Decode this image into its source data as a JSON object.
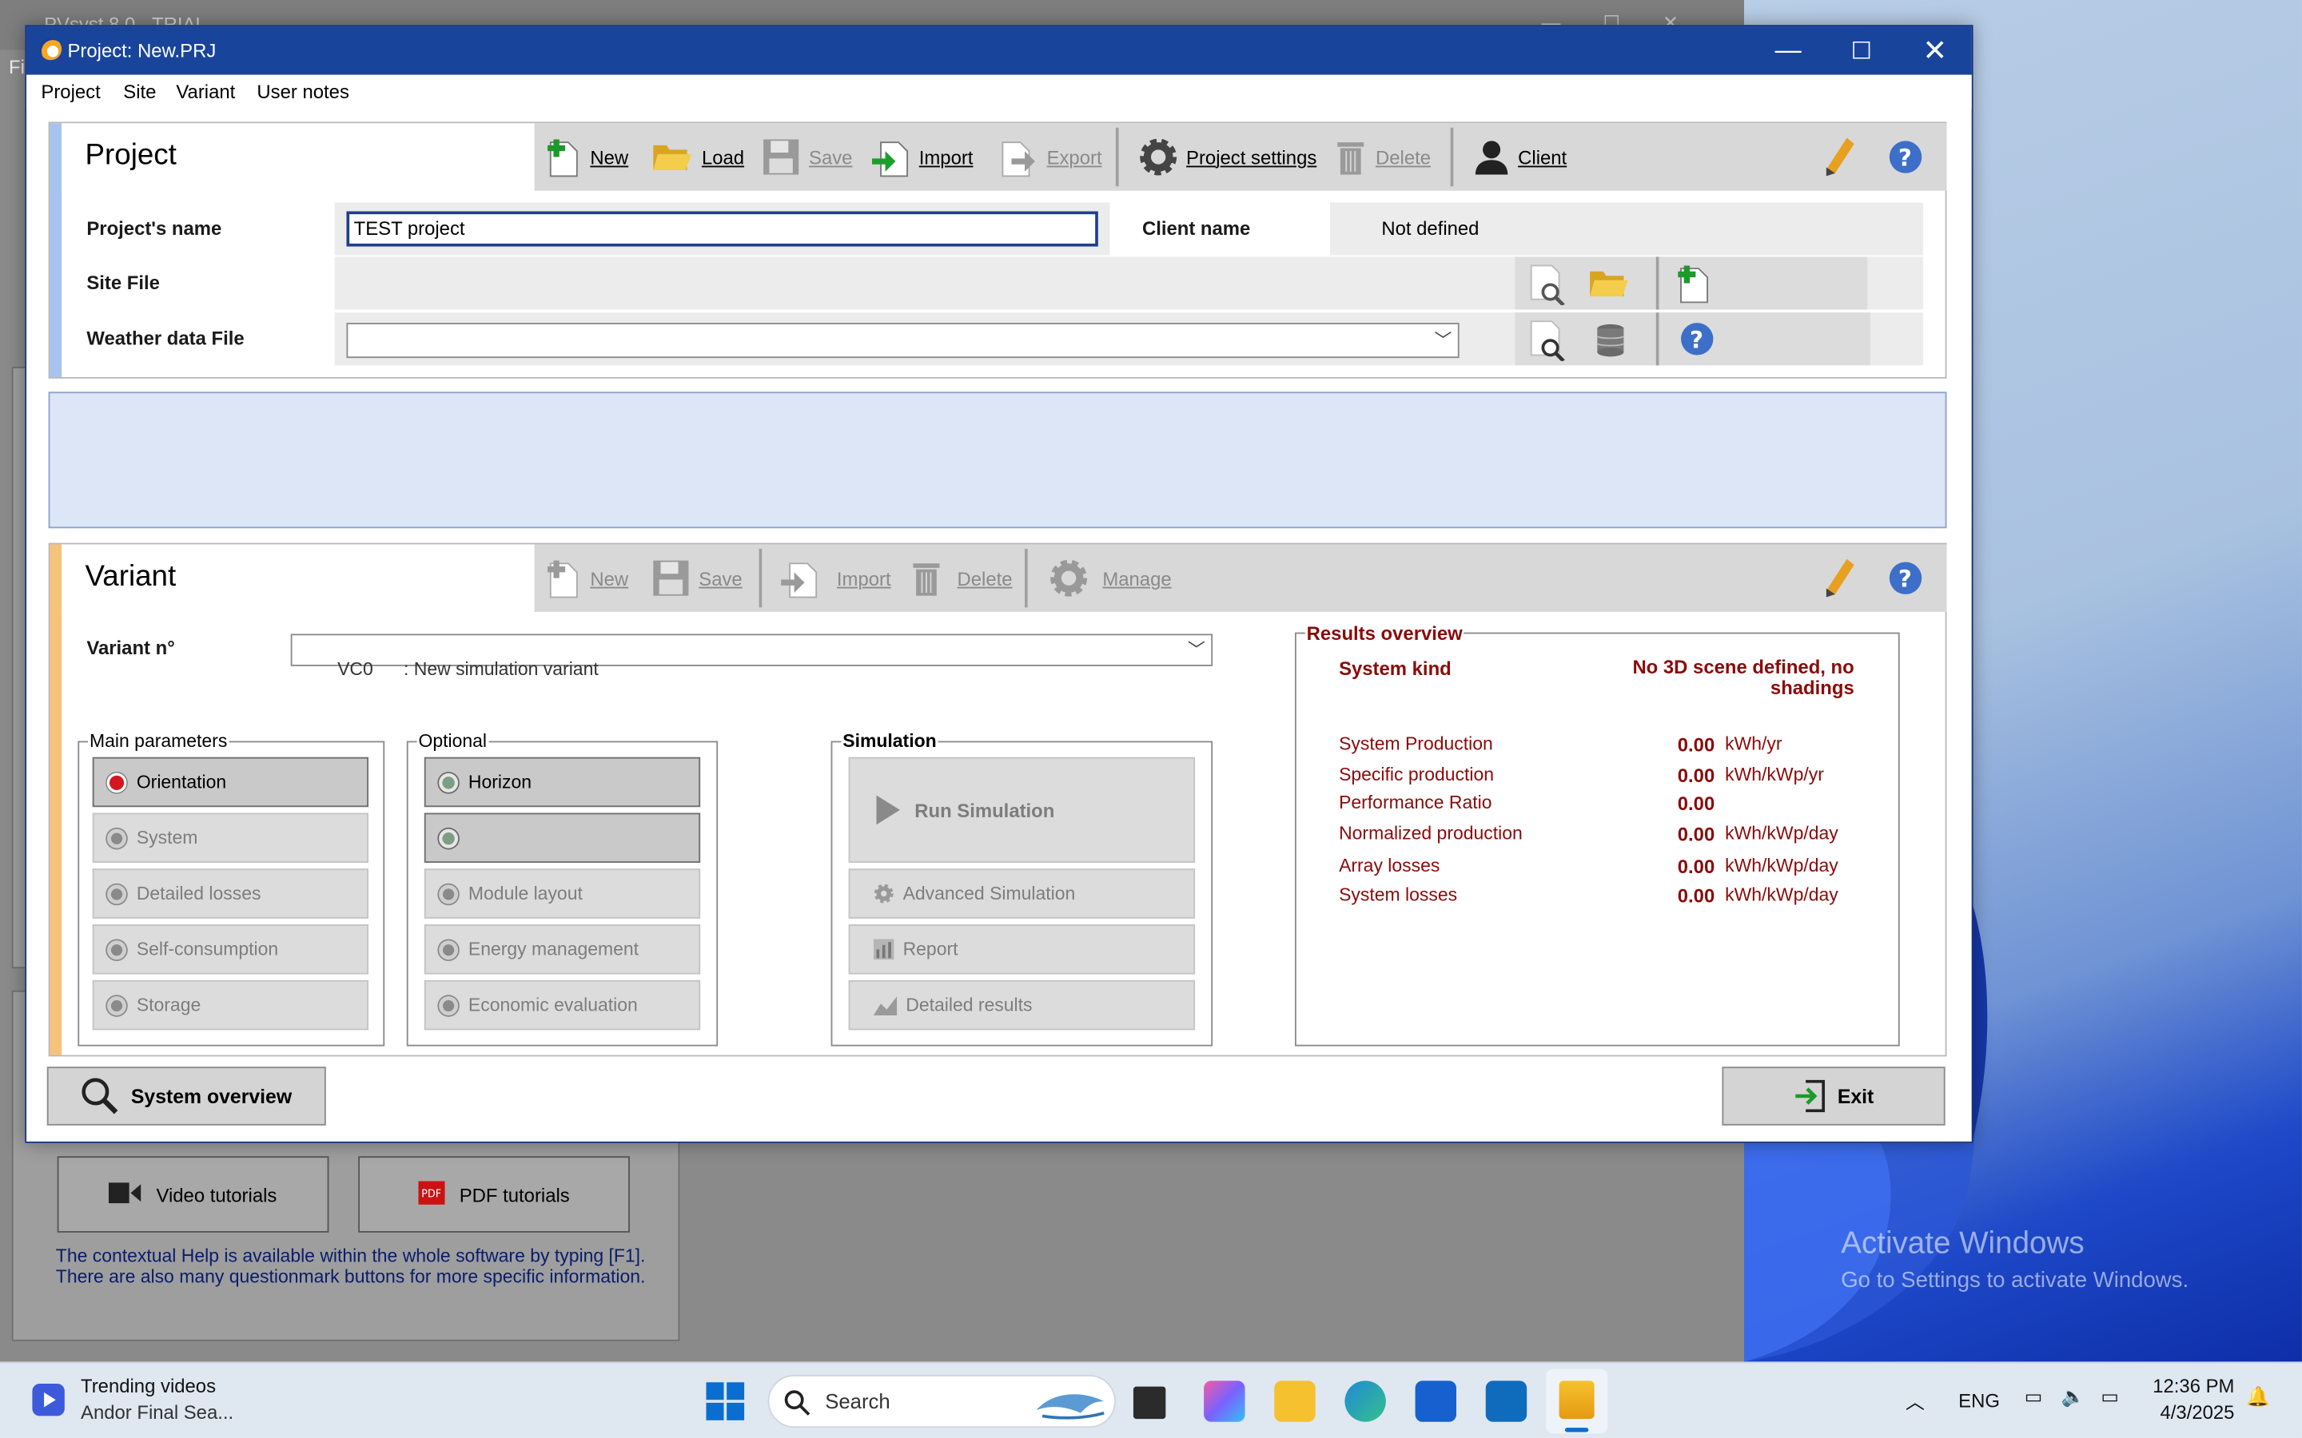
{
  "background_app": {
    "title": "PVsyst 8.0 - TRIAL",
    "menu_fragment": "Fi",
    "video_tutorials": "Video tutorials",
    "pdf_tutorials": "PDF tutorials",
    "help_text_1": "The contextual Help is available within the whole software by typing [F1].",
    "help_text_2": "There are also many questionmark buttons for more specific information."
  },
  "watermark": {
    "line1": "Activate Windows",
    "line2": "Go to Settings to activate Windows."
  },
  "window": {
    "title": "Project:  New.PRJ"
  },
  "menu": [
    "Project",
    "Site",
    "Variant",
    "User notes"
  ],
  "project": {
    "heading": "Project",
    "toolbar": {
      "new": "New",
      "load": "Load",
      "save": "Save",
      "import": "Import",
      "export": "Export",
      "settings": "Project settings",
      "delete": "Delete",
      "client": "Client"
    },
    "name_label": "Project's name",
    "name_value": "TEST project",
    "client_label": "Client name",
    "client_value": "Not defined",
    "site_label": "Site File",
    "weather_label": "Weather data File"
  },
  "variant": {
    "heading": "Variant",
    "toolbar": {
      "new": "New",
      "save": "Save",
      "import": "Import",
      "delete": "Delete",
      "manage": "Manage"
    },
    "number_label": "Variant n°",
    "number_value": "VC0      : New simulation variant",
    "main_params": {
      "title": "Main parameters",
      "items": [
        "Orientation",
        "System",
        "Detailed losses",
        "Self-consumption",
        "Storage"
      ]
    },
    "optional": {
      "title": "Optional",
      "items": [
        "Horizon",
        "",
        "Module layout",
        "Energy management",
        "Economic evaluation"
      ]
    },
    "simulation": {
      "title": "Simulation",
      "run": "Run Simulation",
      "advanced": "Advanced Simulation",
      "report": "Report",
      "detailed": "Detailed results"
    },
    "results": {
      "title": "Results overview",
      "system_kind_label": "System kind",
      "system_kind_value": "No 3D scene defined, no shadings",
      "rows": [
        {
          "label": "System Production",
          "value": "0.00",
          "unit": "kWh/yr"
        },
        {
          "label": "Specific production",
          "value": "0.00",
          "unit": "kWh/kWp/yr"
        },
        {
          "label": "Performance Ratio",
          "value": "0.00",
          "unit": ""
        },
        {
          "label": "Normalized production",
          "value": "0.00",
          "unit": "kWh/kWp/day"
        },
        {
          "label": "Array losses",
          "value": "0.00",
          "unit": "kWh/kWp/day"
        },
        {
          "label": "System losses",
          "value": "0.00",
          "unit": "kWh/kWp/day"
        }
      ]
    }
  },
  "bottom": {
    "overview": "System overview",
    "exit": "Exit"
  },
  "taskbar": {
    "news_title": "Trending videos",
    "news_sub": "Andor Final Sea...",
    "search": "Search",
    "lang": "ENG",
    "time": "12:36 PM",
    "date": "4/3/2025"
  },
  "colors": {
    "title_bar": "#19449c",
    "project_accent": "#a9c3ef",
    "variant_accent": "#f7c27a",
    "result_red": "#8a0b0b"
  }
}
